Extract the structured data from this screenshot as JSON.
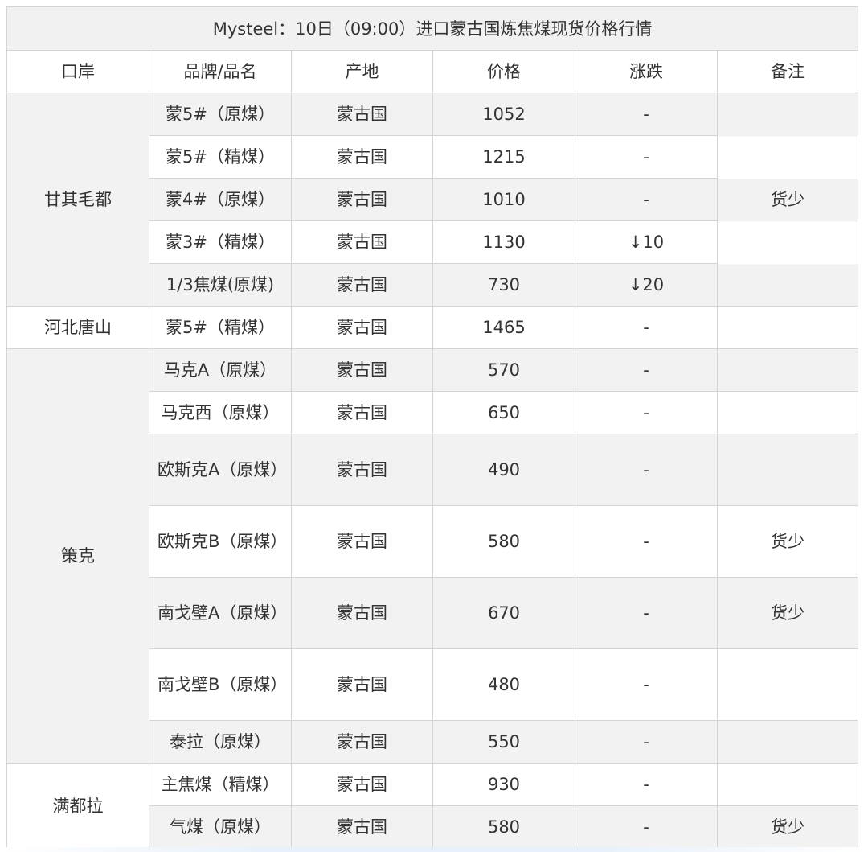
{
  "title": "Mysteel：10日（09:00）进口蒙古国炼焦煤现货价格行情",
  "headers": [
    "口岸",
    "品牌/品名",
    "产地",
    "价格",
    "涨跌",
    "备注"
  ],
  "ports": {
    "p0": "甘其毛都",
    "p1": "河北唐山",
    "p2": "策克",
    "p3": "满都拉"
  },
  "rows": [
    {
      "brand": "蒙5#（原煤）",
      "origin": "蒙古国",
      "price": "1052",
      "change": "-",
      "remark": ""
    },
    {
      "brand": "蒙5#（精煤）",
      "origin": "蒙古国",
      "price": "1215",
      "change": "-",
      "remark": ""
    },
    {
      "brand": "蒙4#（原煤）",
      "origin": "蒙古国",
      "price": "1010",
      "change": "-",
      "remark": "货少"
    },
    {
      "brand": "蒙3#（精煤）",
      "origin": "蒙古国",
      "price": "1130",
      "change": "↓10",
      "remark": ""
    },
    {
      "brand": "1/3焦煤(原煤)",
      "origin": "蒙古国",
      "price": "730",
      "change": "↓20",
      "remark": ""
    },
    {
      "brand": "蒙5#（精煤）",
      "origin": "蒙古国",
      "price": "1465",
      "change": "-",
      "remark": ""
    },
    {
      "brand": "马克A（原煤）",
      "origin": "蒙古国",
      "price": "570",
      "change": "-",
      "remark": ""
    },
    {
      "brand": "马克西（原煤）",
      "origin": "蒙古国",
      "price": "650",
      "change": "-",
      "remark": ""
    },
    {
      "brand": "欧斯克A（原煤）",
      "origin": "蒙古国",
      "price": "490",
      "change": "-",
      "remark": ""
    },
    {
      "brand": "欧斯克B（原煤）",
      "origin": "蒙古国",
      "price": "580",
      "change": "-",
      "remark": "货少"
    },
    {
      "brand": "南戈壁A（原煤）",
      "origin": "蒙古国",
      "price": "670",
      "change": "-",
      "remark": "货少"
    },
    {
      "brand": "南戈壁B（原煤）",
      "origin": "蒙古国",
      "price": "480",
      "change": "-",
      "remark": ""
    },
    {
      "brand": "泰拉（原煤）",
      "origin": "蒙古国",
      "price": "550",
      "change": "-",
      "remark": ""
    },
    {
      "brand": "主焦煤（精煤）",
      "origin": "蒙古国",
      "price": "930",
      "change": "-",
      "remark": ""
    },
    {
      "brand": "气煤（原煤）",
      "origin": "蒙古国",
      "price": "580",
      "change": "-",
      "remark": "货少"
    }
  ],
  "colors": {
    "title_bg": "#f1f1f1",
    "grey_row_bg": "#f2f2f2",
    "border": "#d4d4d4",
    "down_green": "#1aa83c",
    "text": "#333333"
  }
}
